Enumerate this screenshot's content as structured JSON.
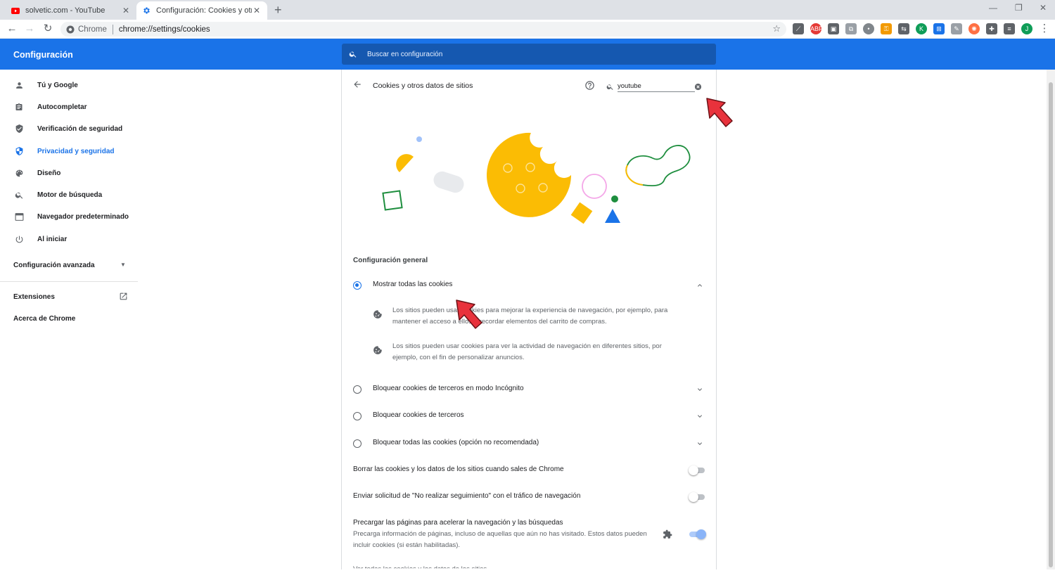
{
  "browser": {
    "tabs": [
      {
        "title": "solvetic.com - YouTube",
        "icon": "youtube-icon"
      },
      {
        "title": "Configuración: Cookies y otros d",
        "icon": "settings-gear-icon"
      }
    ],
    "site_chip": "Chrome",
    "url": "chrome://settings/cookies",
    "profile_initial": "J"
  },
  "header": {
    "title": "Configuración",
    "search_placeholder": "Buscar en configuración"
  },
  "sidebar": {
    "items": [
      {
        "label": "Tú y Google",
        "icon": "person-icon"
      },
      {
        "label": "Autocompletar",
        "icon": "clipboard-icon"
      },
      {
        "label": "Verificación de seguridad",
        "icon": "shield-check-icon"
      },
      {
        "label": "Privacidad y seguridad",
        "icon": "shield-icon",
        "active": true
      },
      {
        "label": "Diseño",
        "icon": "palette-icon"
      },
      {
        "label": "Motor de búsqueda",
        "icon": "search-icon"
      },
      {
        "label": "Navegador predeterminado",
        "icon": "browser-icon"
      },
      {
        "label": "Al iniciar",
        "icon": "power-icon"
      }
    ],
    "advanced": "Configuración avanzada",
    "extensions": "Extensiones",
    "about": "Acerca de Chrome"
  },
  "card": {
    "title": "Cookies y otros datos de sitios",
    "filter_value": "youtube",
    "section_label": "Configuración general",
    "options": [
      {
        "label": "Mostrar todas las cookies",
        "checked": true,
        "expanded": true
      },
      {
        "label": "Bloquear cookies de terceros en modo Incógnito",
        "checked": false
      },
      {
        "label": "Bloquear cookies de terceros",
        "checked": false
      },
      {
        "label": "Bloquear todas las cookies (opción no recomendada)",
        "checked": false
      }
    ],
    "descriptions": [
      "Los sitios pueden usar cookies para mejorar la experiencia de navegación, por ejemplo, para mantener el acceso a ellos o recordar elementos del carrito de compras.",
      "Los sitios pueden usar cookies para ver la actividad de navegación en diferentes sitios, por ejemplo, con el fin de personalizar anuncios."
    ],
    "toggles": [
      {
        "label": "Borrar las cookies y los datos de los sitios cuando sales de Chrome",
        "on": false
      },
      {
        "label": "Enviar solicitud de \"No realizar seguimiento\" con el tráfico de navegación",
        "on": false
      }
    ],
    "preload": {
      "title": "Precargar las páginas para acelerar la navegación y las búsquedas",
      "description": "Precarga información de páginas, incluso de aquellas que aún no has visitado. Estos datos pueden incluir cookies (si están habilitadas).",
      "on": true
    },
    "cut_off_text": "Ver todas las cookies y los datos de los sitios"
  },
  "colors": {
    "accent": "#1a73e8",
    "header_bg": "#1a73e8",
    "annotation_arrow": "#e8323c"
  }
}
